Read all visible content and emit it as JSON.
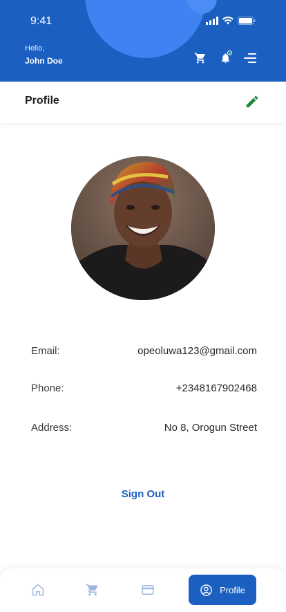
{
  "status_bar": {
    "time": "9:41"
  },
  "header": {
    "greeting": "Hello,",
    "user_name": "John Doe",
    "icons": [
      "cart-icon",
      "bell-icon",
      "menu-icon"
    ]
  },
  "page": {
    "title": "Profile"
  },
  "profile": {
    "fields": [
      {
        "label": "Email:",
        "value": "opeoluwa123@gmail.com"
      },
      {
        "label": "Phone:",
        "value": "+2348167902468"
      },
      {
        "label": "Address:",
        "value": "No 8, Orogun Street"
      }
    ],
    "sign_out_label": "Sign Out"
  },
  "bottom_nav": {
    "items": [
      {
        "icon": "home-icon"
      },
      {
        "icon": "cart-icon"
      },
      {
        "icon": "card-icon"
      },
      {
        "icon": "profile-icon",
        "label": "Profile",
        "active": true
      }
    ]
  },
  "colors": {
    "primary": "#1b5fc1",
    "accent_green": "#1e8a3e",
    "notification_dot": "#2bd16b"
  }
}
